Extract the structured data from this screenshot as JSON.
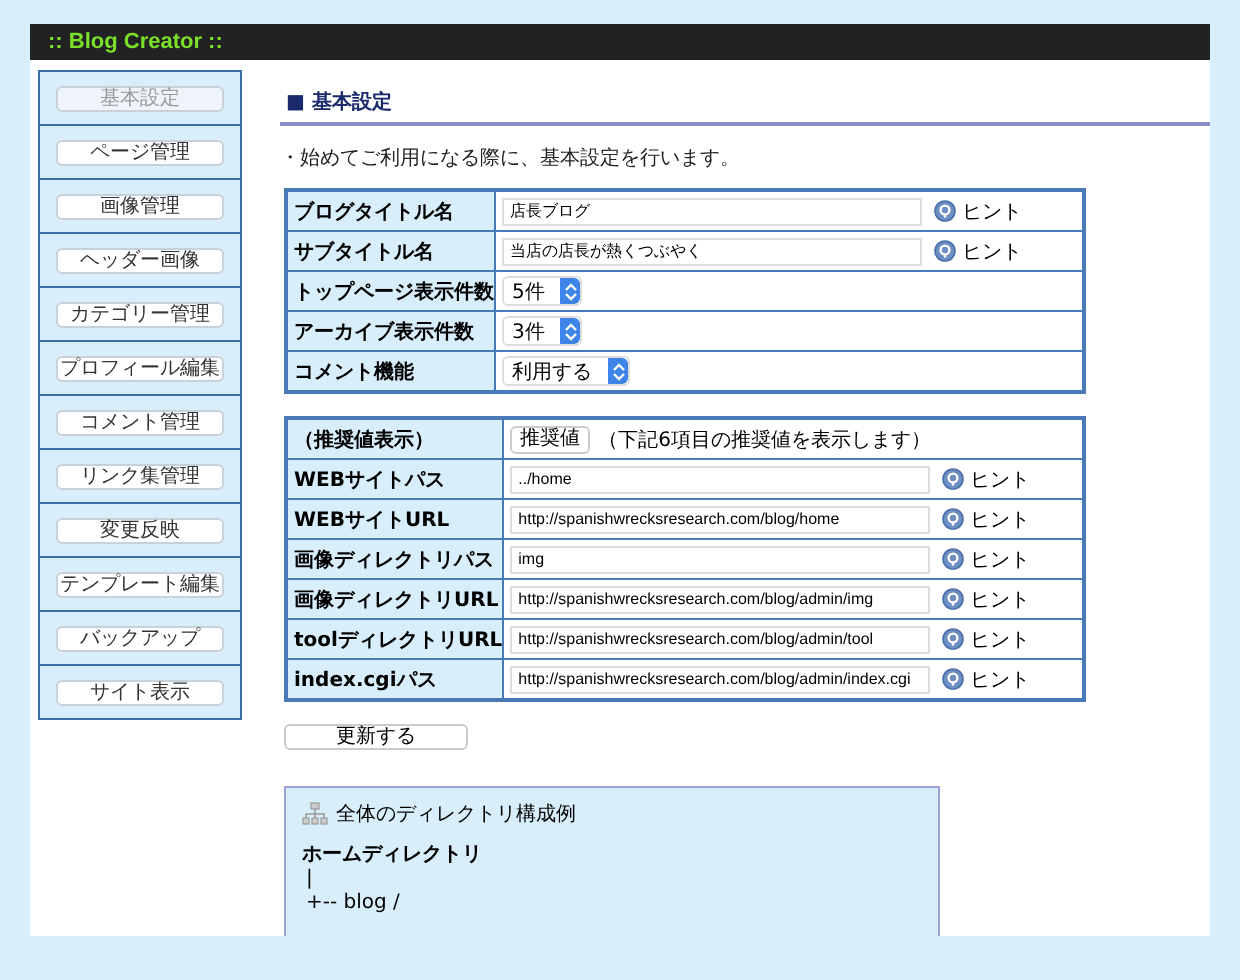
{
  "header": {
    "title": ":: Blog Creator ::"
  },
  "sidebar": {
    "items": [
      {
        "label": "基本設定",
        "selected": true
      },
      {
        "label": "ページ管理",
        "selected": false
      },
      {
        "label": "画像管理",
        "selected": false
      },
      {
        "label": "ヘッダー画像",
        "selected": false
      },
      {
        "label": "カテゴリー管理",
        "selected": false
      },
      {
        "label": "プロフィール編集",
        "selected": false
      },
      {
        "label": "コメント管理",
        "selected": false
      },
      {
        "label": "リンク集管理",
        "selected": false
      },
      {
        "label": "変更反映",
        "selected": false
      },
      {
        "label": "テンプレート編集",
        "selected": false
      },
      {
        "label": "バックアップ",
        "selected": false
      },
      {
        "label": "サイト表示",
        "selected": false
      }
    ]
  },
  "section_title": "■ 基本設定",
  "description": "・始めてご利用になる際に、基本設定を行います。",
  "tables": [
    {
      "rows": [
        {
          "kind": "text",
          "label": "ブログタイトル名",
          "value": "店長ブログ",
          "hint": "ヒント"
        },
        {
          "kind": "text",
          "label": "サブタイトル名",
          "value": "当店の店長が熱くつぶやく",
          "hint": "ヒント"
        },
        {
          "kind": "select",
          "label": "トップページ表示件数",
          "value": "5件"
        },
        {
          "kind": "select",
          "label": "アーカイブ表示件数",
          "value": "3件"
        },
        {
          "kind": "select",
          "label": "コメント機能",
          "value": "利用する"
        }
      ]
    },
    {
      "rows": [
        {
          "kind": "button",
          "label": "（推奨値表示）",
          "button": "推奨値",
          "note": "（下記6項目の推奨値を表示します）"
        },
        {
          "kind": "text",
          "label": "WEBサイトパス",
          "value": "../home",
          "hint": "ヒント"
        },
        {
          "kind": "text",
          "label": "WEBサイトURL",
          "value": "http://spanishwrecksresearch.com/blog/home",
          "hint": "ヒント"
        },
        {
          "kind": "text",
          "label": "画像ディレクトリパス",
          "value": "img",
          "hint": "ヒント"
        },
        {
          "kind": "text",
          "label": "画像ディレクトリURL",
          "value": "http://spanishwrecksresearch.com/blog/admin/img",
          "hint": "ヒント"
        },
        {
          "kind": "text",
          "label": "toolディレクトリURL",
          "value": "http://spanishwrecksresearch.com/blog/admin/tool",
          "hint": "ヒント"
        },
        {
          "kind": "text",
          "label": "index.cgiパス",
          "value": "http://spanishwrecksresearch.com/blog/admin/index.cgi",
          "hint": "ヒント"
        }
      ]
    }
  ],
  "submit_button": "更新する",
  "directory_box": {
    "title": "全体のディレクトリ構成例",
    "lines": [
      "ホームディレクトリ",
      "|",
      "+-- blog /"
    ]
  }
}
